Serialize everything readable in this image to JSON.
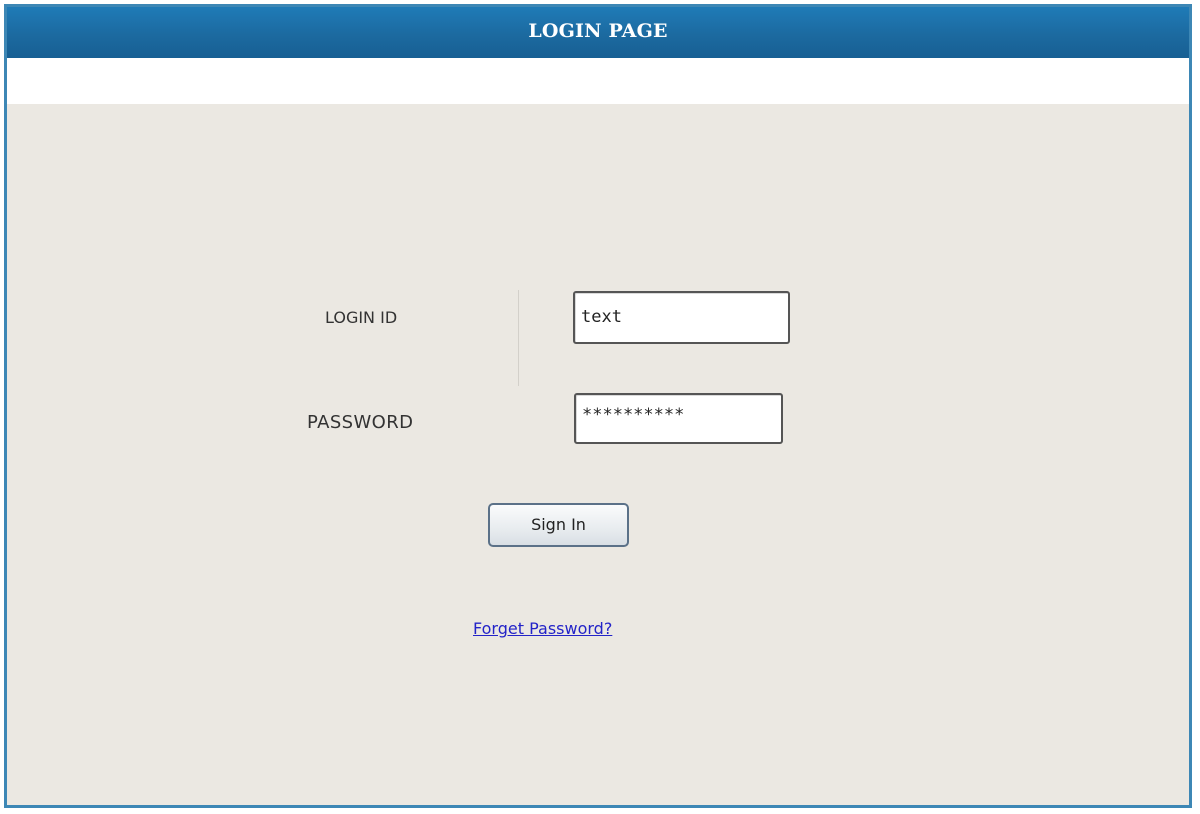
{
  "header": {
    "title": "LOGIN PAGE"
  },
  "form": {
    "login_id_label": "LOGIN ID",
    "login_id_value": "text",
    "password_label": "PASSWORD",
    "password_value": "**********",
    "sign_in_label": "Sign In",
    "forgot_link": "Forget Password?"
  },
  "colors": {
    "header_bg": "#1c6aa0",
    "frame_border": "#3d87b5",
    "page_bg": "#ebe8e2",
    "link": "#2323c8"
  }
}
